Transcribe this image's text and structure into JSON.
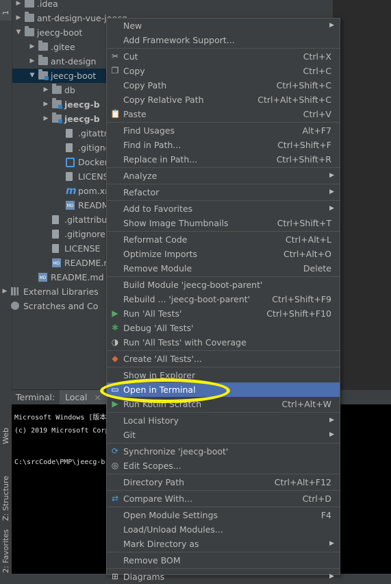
{
  "left_stripe": {
    "top_tab": "1",
    "web_tab": "Web",
    "structure_tab": "Z: Structure",
    "favorites_tab": "2: Favorites"
  },
  "tree": {
    "items": [
      {
        "label": ".idea",
        "icon": "folder-icon"
      },
      {
        "label": "ant-design-vue-jeecg",
        "icon": "folder-icon"
      },
      {
        "label": "jeecg-boot",
        "icon": "folder-icon"
      },
      {
        "label": ".gitee",
        "icon": "folder-icon"
      },
      {
        "label": "ant-design",
        "icon": "folder-icon"
      },
      {
        "label": "jeecg-boot",
        "icon": "module-folder-icon"
      },
      {
        "label": "db",
        "icon": "folder-icon"
      },
      {
        "label": "jeecg-b",
        "icon": "module-folder-icon"
      },
      {
        "label": "jeecg-b",
        "icon": "module-folder-icon"
      },
      {
        "label": ".gitattrib",
        "icon": "file-icon"
      },
      {
        "label": ".gitigno",
        "icon": "file-icon"
      },
      {
        "label": "Dockerf",
        "icon": "docker-file-icon"
      },
      {
        "label": "LICENSE",
        "icon": "file-icon"
      },
      {
        "label": "pom.xm",
        "icon": "maven-icon"
      },
      {
        "label": "README",
        "icon": "markdown-icon"
      },
      {
        "label": ".gitattribute",
        "icon": "file-icon"
      },
      {
        "label": ".gitignore",
        "icon": "file-icon"
      },
      {
        "label": "LICENSE",
        "icon": "file-icon"
      },
      {
        "label": "README.m",
        "icon": "markdown-icon"
      },
      {
        "label": "README.md",
        "icon": "markdown-icon"
      },
      {
        "label": "External Libraries",
        "icon": "libraries-icon"
      },
      {
        "label": "Scratches and Co",
        "icon": "scratches-icon"
      }
    ]
  },
  "terminal": {
    "title": "Terminal:",
    "tab": "Local",
    "close": "×",
    "lines": [
      "Microsoft Windows [版本",
      "(c) 2019 Microsoft Corp",
      "C:\\srcCode\\PMP\\jeecg-b"
    ]
  },
  "menu": {
    "items": [
      {
        "label": "New",
        "shortcut": "",
        "submenu": true,
        "icon": ""
      },
      {
        "label": "Add Framework Support...",
        "shortcut": "",
        "submenu": false,
        "icon": ""
      },
      {
        "label": "Cut",
        "shortcut": "Ctrl+X",
        "submenu": false,
        "icon": "scissors-icon"
      },
      {
        "label": "Copy",
        "shortcut": "Ctrl+C",
        "submenu": false,
        "icon": "copy-icon"
      },
      {
        "label": "Copy Path",
        "shortcut": "Ctrl+Shift+C",
        "submenu": false,
        "icon": ""
      },
      {
        "label": "Copy Relative Path",
        "shortcut": "Ctrl+Alt+Shift+C",
        "submenu": false,
        "icon": ""
      },
      {
        "label": "Paste",
        "shortcut": "Ctrl+V",
        "submenu": false,
        "icon": "paste-icon"
      },
      {
        "label": "Find Usages",
        "shortcut": "Alt+F7",
        "submenu": false,
        "icon": ""
      },
      {
        "label": "Find in Path...",
        "shortcut": "Ctrl+Shift+F",
        "submenu": false,
        "icon": ""
      },
      {
        "label": "Replace in Path...",
        "shortcut": "Ctrl+Shift+R",
        "submenu": false,
        "icon": ""
      },
      {
        "label": "Analyze",
        "shortcut": "",
        "submenu": true,
        "icon": ""
      },
      {
        "label": "Refactor",
        "shortcut": "",
        "submenu": true,
        "icon": ""
      },
      {
        "label": "Add to Favorites",
        "shortcut": "",
        "submenu": true,
        "icon": ""
      },
      {
        "label": "Show Image Thumbnails",
        "shortcut": "Ctrl+Shift+T",
        "submenu": false,
        "icon": ""
      },
      {
        "label": "Reformat Code",
        "shortcut": "Ctrl+Alt+L",
        "submenu": false,
        "icon": ""
      },
      {
        "label": "Optimize Imports",
        "shortcut": "Ctrl+Alt+O",
        "submenu": false,
        "icon": ""
      },
      {
        "label": "Remove Module",
        "shortcut": "Delete",
        "submenu": false,
        "icon": ""
      },
      {
        "label": "Build Module 'jeecg-boot-parent'",
        "shortcut": "",
        "submenu": false,
        "icon": ""
      },
      {
        "label": "Rebuild ... 'jeecg-boot-parent'",
        "shortcut": "Ctrl+Shift+F9",
        "submenu": false,
        "icon": ""
      },
      {
        "label": "Run 'All Tests'",
        "shortcut": "Ctrl+Shift+F10",
        "submenu": false,
        "icon": "run-icon"
      },
      {
        "label": "Debug 'All Tests'",
        "shortcut": "",
        "submenu": false,
        "icon": "debug-icon"
      },
      {
        "label": "Run 'All Tests' with Coverage",
        "shortcut": "",
        "submenu": false,
        "icon": "coverage-icon"
      },
      {
        "label": "Create 'All Tests'...",
        "shortcut": "",
        "submenu": false,
        "icon": "create-config-icon"
      },
      {
        "label": "Show in Explorer",
        "shortcut": "",
        "submenu": false,
        "icon": ""
      },
      {
        "label": "Open in Terminal",
        "shortcut": "",
        "submenu": false,
        "icon": "terminal-icon"
      },
      {
        "label": "Run Kotlin Scratch",
        "shortcut": "Ctrl+Alt+W",
        "submenu": false,
        "icon": "run-icon"
      },
      {
        "label": "Local History",
        "shortcut": "",
        "submenu": true,
        "icon": ""
      },
      {
        "label": "Git",
        "shortcut": "",
        "submenu": true,
        "icon": ""
      },
      {
        "label": "Synchronize 'jeecg-boot'",
        "shortcut": "",
        "submenu": false,
        "icon": "sync-icon"
      },
      {
        "label": "Edit Scopes...",
        "shortcut": "",
        "submenu": false,
        "icon": "scopes-icon"
      },
      {
        "label": "Directory Path",
        "shortcut": "Ctrl+Alt+F12",
        "submenu": false,
        "icon": ""
      },
      {
        "label": "Compare With...",
        "shortcut": "Ctrl+D",
        "submenu": false,
        "icon": "compare-icon"
      },
      {
        "label": "Open Module Settings",
        "shortcut": "F4",
        "submenu": false,
        "icon": ""
      },
      {
        "label": "Load/Unload Modules...",
        "shortcut": "",
        "submenu": false,
        "icon": ""
      },
      {
        "label": "Mark Directory as",
        "shortcut": "",
        "submenu": true,
        "icon": ""
      },
      {
        "label": "Remove BOM",
        "shortcut": "",
        "submenu": false,
        "icon": ""
      },
      {
        "label": "Diagrams",
        "shortcut": "",
        "submenu": true,
        "icon": "diagram-icon"
      }
    ],
    "highlighted": "Open in Terminal"
  },
  "colors": {
    "highlight": "#4b6eaf",
    "annotation": "#f7f10f",
    "run": "#59a869",
    "debug": "#499c54"
  }
}
